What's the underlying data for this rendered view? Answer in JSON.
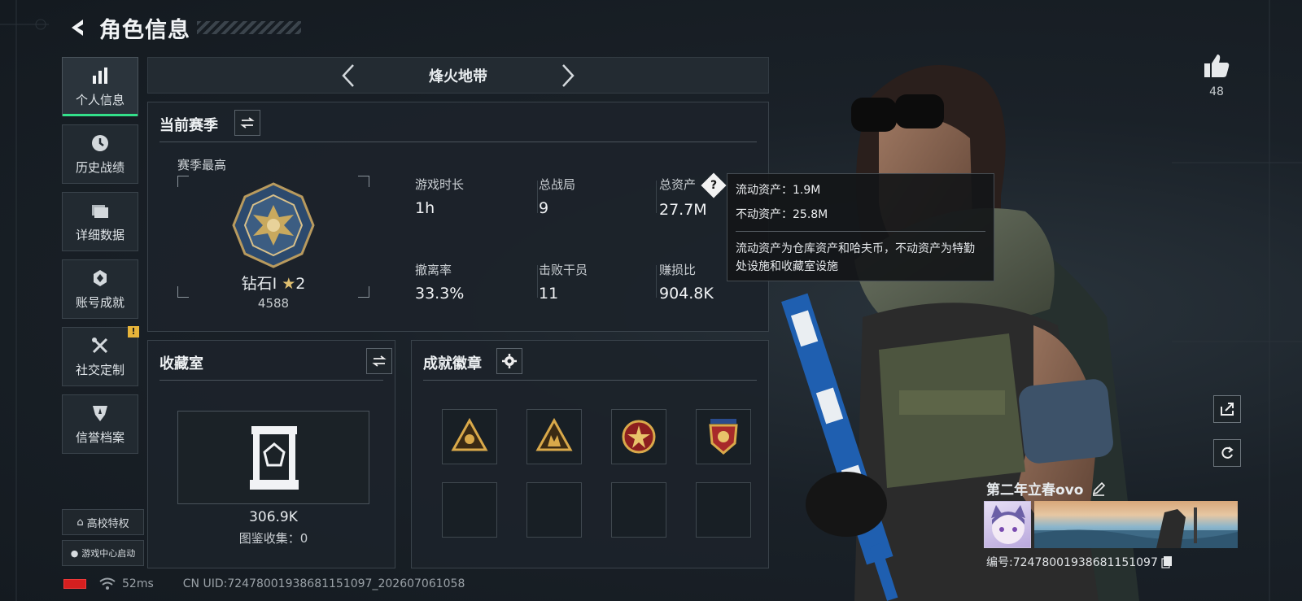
{
  "header": {
    "title": "角色信息"
  },
  "nav": {
    "items": [
      {
        "label": "个人信息",
        "icon": "bar-chart-icon",
        "active": true
      },
      {
        "label": "历史战绩",
        "icon": "clock-icon"
      },
      {
        "label": "详细数据",
        "icon": "folder-icon"
      },
      {
        "label": "账号成就",
        "icon": "achievement-icon"
      },
      {
        "label": "社交定制",
        "icon": "tools-icon",
        "badge": "!"
      },
      {
        "label": "信誉档案",
        "icon": "shield-icon"
      }
    ],
    "school_privilege": "高校特权",
    "game_center": "游戏中心启动"
  },
  "mode": {
    "name": "烽火地带"
  },
  "season": {
    "title": "当前赛季",
    "peak_label": "赛季最高",
    "rank": "钻石Ⅰ",
    "stars": "2",
    "score": "4588",
    "stats": [
      {
        "label": "游戏时长",
        "value": "1h"
      },
      {
        "label": "总战局",
        "value": "9"
      },
      {
        "label": "总资产",
        "value": "27.7M"
      },
      {
        "label": "撤离率",
        "value": "33.3%"
      },
      {
        "label": "击败干员",
        "value": "11"
      },
      {
        "label": "赚损比",
        "value": "904.8K"
      }
    ]
  },
  "tooltip": {
    "liquid": "流动资产：1.9M",
    "fixed": "不动资产：25.8M",
    "desc": "流动资产为仓库资产和哈夫币，不动资产为特勤处设施和收藏室设施"
  },
  "collection": {
    "title": "收藏室",
    "value": "306.9K",
    "count": "图鉴收集：0"
  },
  "badges": {
    "title": "成就徽章"
  },
  "player": {
    "likes": "48",
    "name": "第二年立春ovo",
    "id": "编号:7247800193868115109​7"
  },
  "status": {
    "ping": "52ms",
    "uid": "CN UID:7247800193868115109​7_202607061058"
  },
  "colors": {
    "accent": "#33e08a",
    "warning": "#e7b43a",
    "battery": "#d51f1f"
  }
}
